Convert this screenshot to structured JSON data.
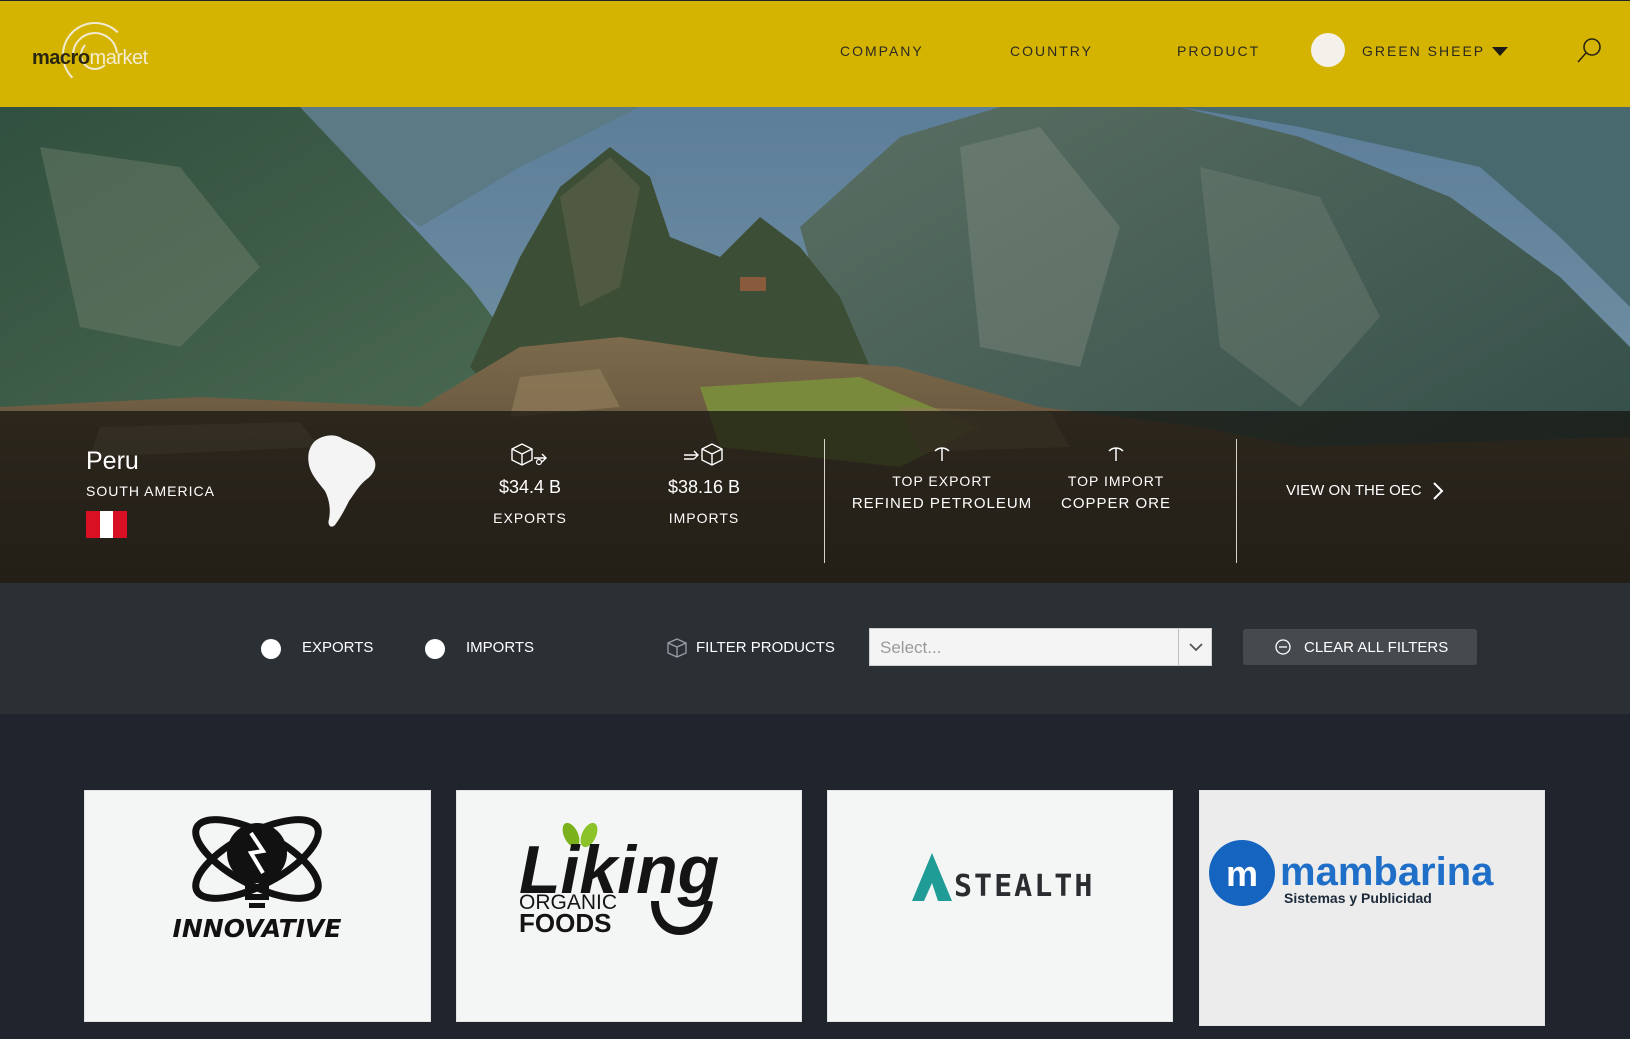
{
  "brand": {
    "logo_bold": "macro",
    "logo_light": "market"
  },
  "nav": {
    "items": [
      {
        "label": "COMPANY"
      },
      {
        "label": "COUNTRY"
      },
      {
        "label": "PRODUCT"
      }
    ],
    "user": {
      "name": "GREEN SHEEP"
    }
  },
  "hero": {
    "country": "Peru",
    "region": "SOUTH AMERICA",
    "flag_colors": [
      "#d91023",
      "#ffffff",
      "#d91023"
    ],
    "exports": {
      "value": "$34.4 B",
      "label": "EXPORTS"
    },
    "imports": {
      "value": "$38.16 B",
      "label": "IMPORTS"
    },
    "top_export": {
      "label": "TOP EXPORT",
      "value": "REFINED PETROLEUM"
    },
    "top_import": {
      "label": "TOP IMPORT",
      "value": "COPPER ORE"
    },
    "oec_link": "VIEW ON THE OEC"
  },
  "filters": {
    "exports_label": "EXPORTS",
    "imports_label": "IMPORTS",
    "filter_products_label": "FILTER PRODUCTS",
    "select_placeholder": "Select...",
    "clear_label": "CLEAR ALL FILTERS"
  },
  "companies": [
    {
      "name": "INNOVATIVE"
    },
    {
      "name_main": "Liking",
      "name_sub1": "ORGANIC",
      "name_sub2": "FOODS"
    },
    {
      "name": "STEALTH"
    },
    {
      "name": "mambarina",
      "tagline": "Sistemas y Publicidad",
      "mark": "m"
    }
  ],
  "colors": {
    "header": "#d4b400",
    "filter_bar": "#2b3035",
    "page_bg": "#1f242d",
    "stealth_teal": "#1f9c95",
    "mambarina_blue": "#1565c0"
  }
}
